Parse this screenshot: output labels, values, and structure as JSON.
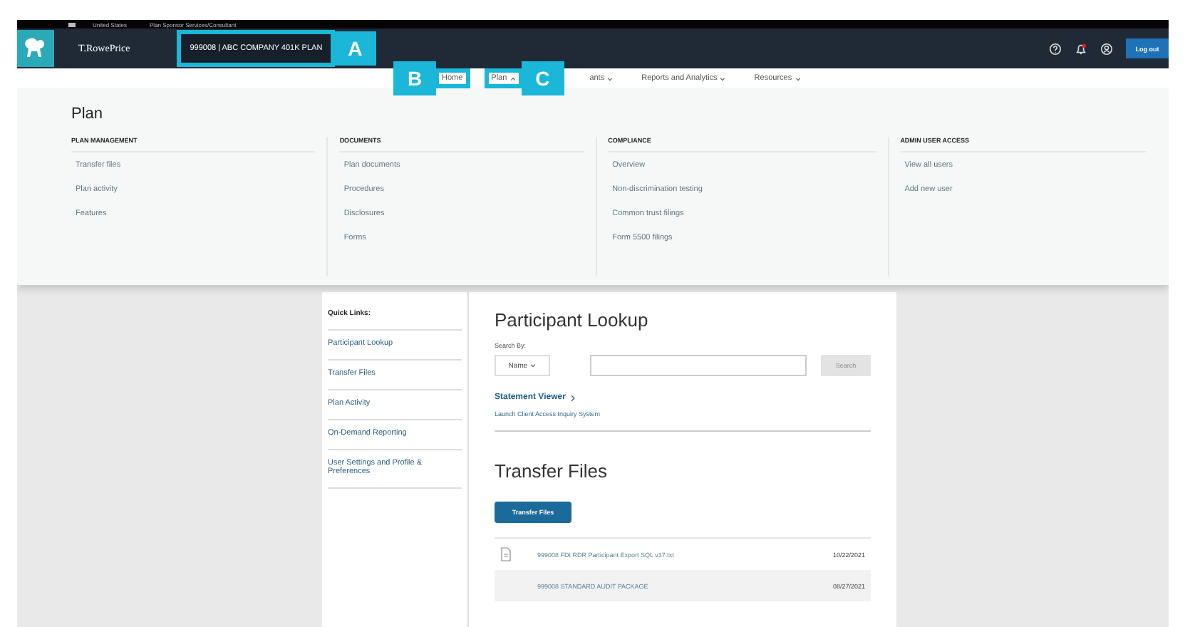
{
  "locale_bar": {
    "region": "United States",
    "site": "Plan Sponsor Services/Consultant"
  },
  "header": {
    "brand": "T.RowePrice",
    "plan_selector": "999008 | ABC COMPANY 401K PLAN",
    "plan_callout": "A",
    "logout": "Log out"
  },
  "nav": [
    {
      "label": "Home",
      "kind": "link",
      "callout": "B"
    },
    {
      "label": "Plan",
      "kind": "menu",
      "expanded": true,
      "callout": "C"
    },
    {
      "label": "ants",
      "kind": "menu",
      "expanded": false
    },
    {
      "label": "Reports and Analytics",
      "kind": "menu",
      "expanded": false
    },
    {
      "label": "Resources",
      "kind": "menu",
      "expanded": false
    }
  ],
  "mega_menu": {
    "title": "Plan",
    "columns": [
      {
        "heading": "PLAN MANAGEMENT",
        "links": [
          "Transfer files",
          "Plan activity",
          "Features"
        ]
      },
      {
        "heading": "DOCUMENTS",
        "links": [
          "Plan documents",
          "Procedures",
          "Disclosures",
          "Forms"
        ]
      },
      {
        "heading": "COMPLIANCE",
        "links": [
          "Overview",
          "Non-discrimination testing",
          "Common trust filings",
          "Form 5500 filings"
        ]
      },
      {
        "heading": "ADMIN USER ACCESS",
        "links": [
          "View all users",
          "Add new user"
        ]
      }
    ]
  },
  "quick_links": {
    "title": "Quick Links:",
    "items": [
      "Participant Lookup",
      "Transfer Files",
      "Plan Activity",
      "On-Demand Reporting",
      "User Settings and Profile & Preferences"
    ]
  },
  "participant_lookup": {
    "title": "Participant Lookup",
    "search_label": "Search By:",
    "search_by": "Name",
    "search_button": "Search",
    "search_disabled": true,
    "statement_link": "Statement Viewer",
    "launch_link": "Launch Client Access Inquiry System"
  },
  "transfer_files": {
    "title": "Transfer Files",
    "button": "Transfer Files",
    "files": [
      {
        "name": "999008 FDI RDR Participant Export SQL v37.txt",
        "date": "10/22/2021",
        "highlighted": false
      },
      {
        "name": "999008 STANDARD AUDIT PACKAGE",
        "date": "08/27/2021",
        "highlighted": true
      }
    ]
  }
}
